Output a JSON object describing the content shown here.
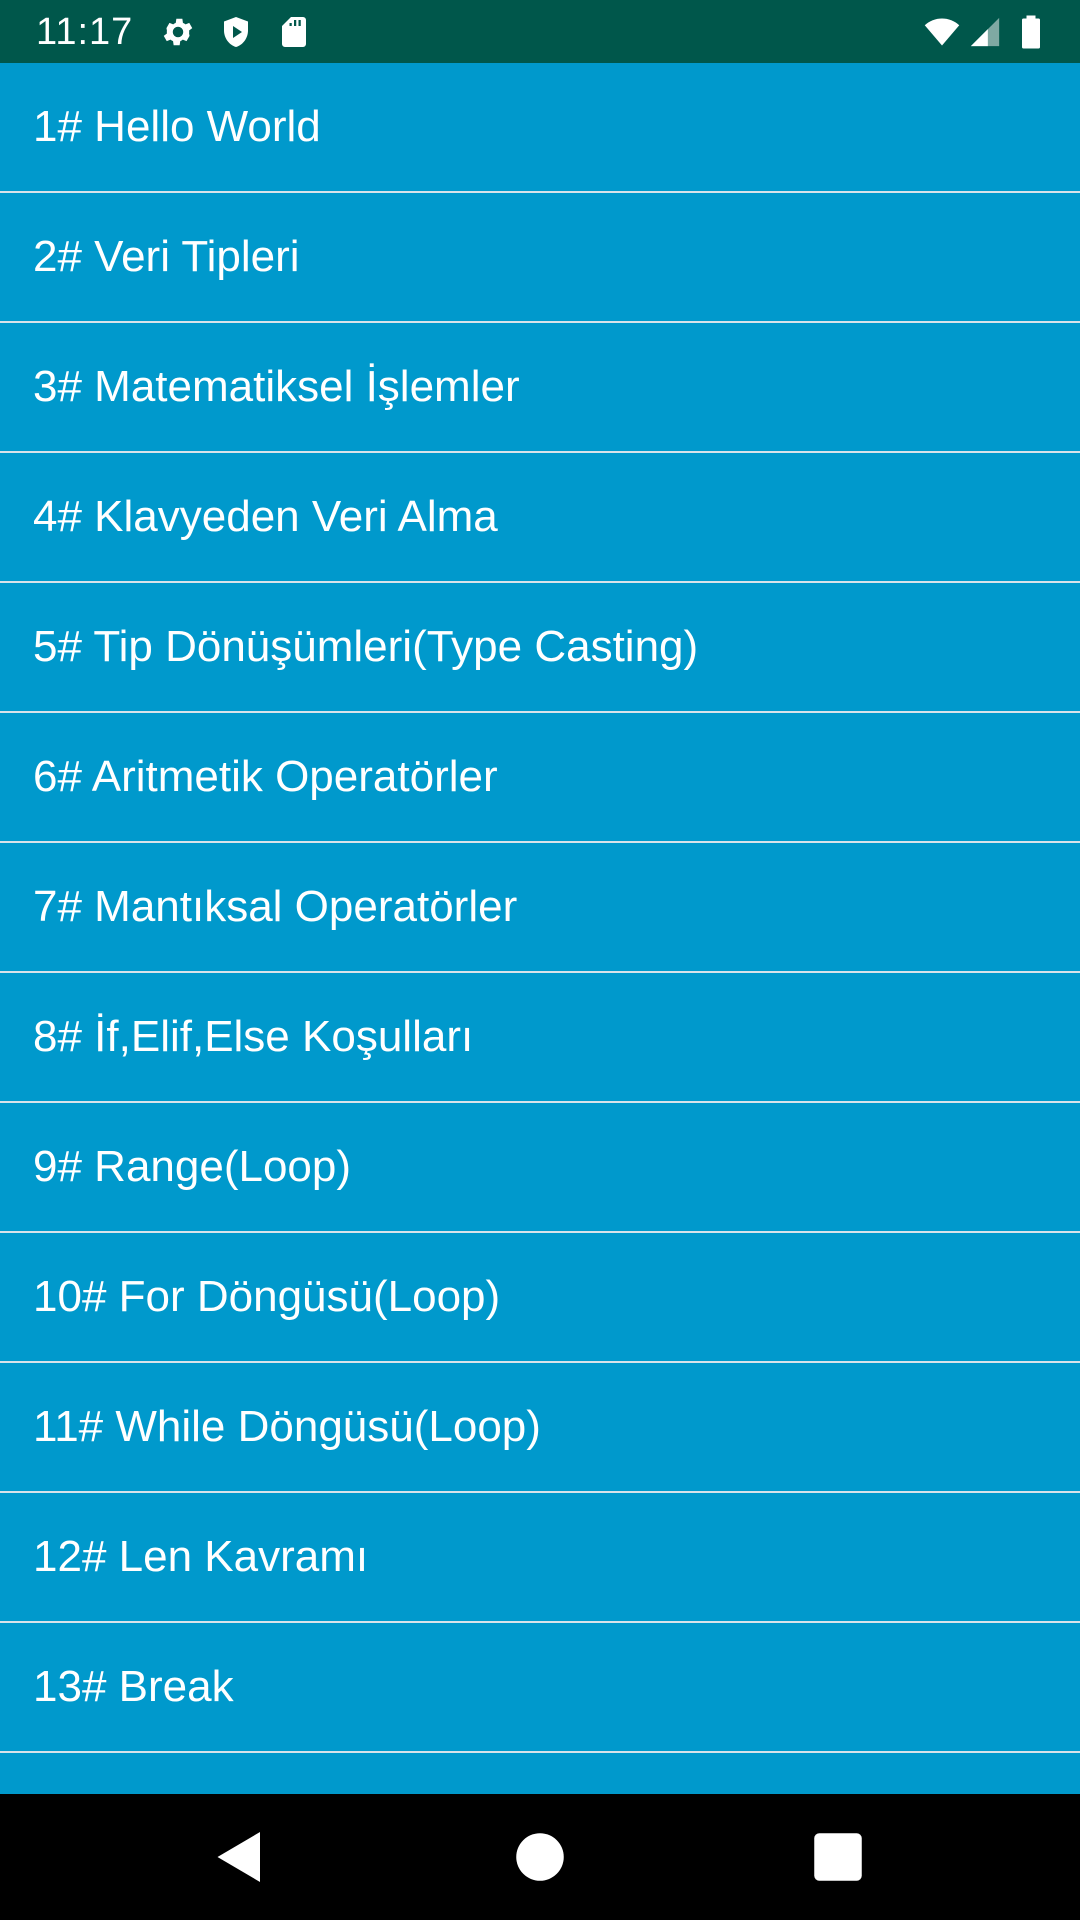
{
  "status_bar": {
    "time": "11:17",
    "icons": [
      "settings-icon",
      "shield-icon",
      "sd-card-icon",
      "wifi-icon",
      "cell-signal-icon",
      "battery-icon"
    ],
    "background": "#00574B"
  },
  "list": {
    "background": "#0099CC",
    "divider_color": "#d9e3ea",
    "items": [
      {
        "label": "1# Hello World"
      },
      {
        "label": "2# Veri Tipleri"
      },
      {
        "label": "3# Matematiksel İşlemler"
      },
      {
        "label": "4# Klavyeden Veri Alma"
      },
      {
        "label": "5# Tip Dönüşümleri(Type Casting)"
      },
      {
        "label": "6# Aritmetik Operatörler"
      },
      {
        "label": "7# Mantıksal Operatörler"
      },
      {
        "label": "8# İf,Elif,Else Koşulları"
      },
      {
        "label": "9# Range(Loop)"
      },
      {
        "label": "10# For Döngüsü(Loop)"
      },
      {
        "label": "11# While Döngüsü(Loop)"
      },
      {
        "label": "12# Len Kavramı"
      },
      {
        "label": "13# Break"
      },
      {
        "label": ""
      }
    ]
  },
  "nav_bar": {
    "buttons": [
      "back-icon",
      "home-icon",
      "recents-icon"
    ],
    "background": "#000000"
  }
}
